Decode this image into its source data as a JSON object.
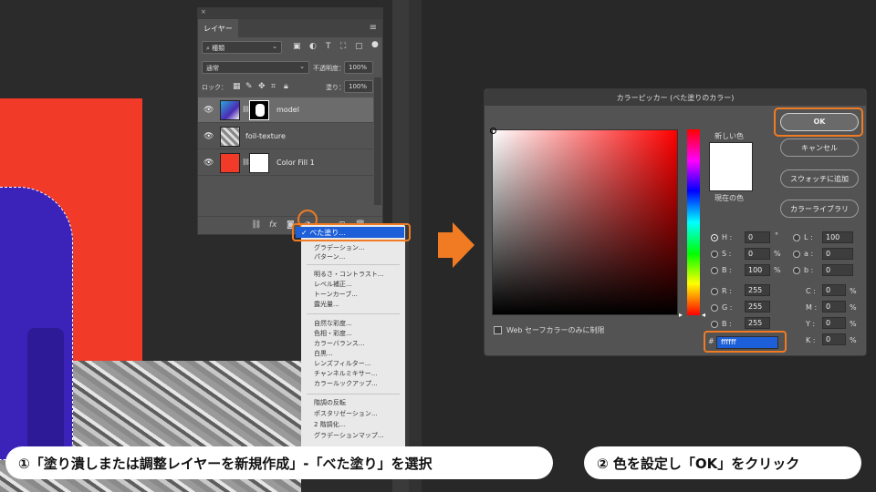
{
  "layers_panel": {
    "close": "×",
    "tab": "レイヤー",
    "menu_icon": "≡",
    "filter_select": "種類",
    "blend_mode": "通常",
    "opacity_label": "不透明度：",
    "opacity_value": "100%",
    "lock_label": "ロック：",
    "fill_label": "塗り：",
    "fill_value": "100%",
    "layers": [
      {
        "name": "model"
      },
      {
        "name": "foil-texture"
      },
      {
        "name": "Color Fill 1"
      }
    ],
    "bottom_icons": [
      "link-icon",
      "fx-icon",
      "mask-icon",
      "adjustment-icon",
      "folder-icon",
      "new-layer-icon",
      "trash-icon"
    ]
  },
  "menu": {
    "items_top": [
      "べた塗り...",
      "グラデーション...",
      "パターン..."
    ],
    "items_group2": [
      "明るさ・コントラスト...",
      "レベル補正...",
      "トーンカーブ...",
      "露光量..."
    ],
    "items_group3": [
      "自然な彩度...",
      "色相・彩度...",
      "カラーバランス...",
      "白黒...",
      "レンズフィルター...",
      "チャンネルミキサー...",
      "カラールックアップ..."
    ],
    "items_group4": [
      "階調の反転",
      "ポスタリゼーション...",
      "2 階調化...",
      "グラデーションマップ..."
    ],
    "checked_item": "✓ べた塗り..."
  },
  "picker": {
    "title": "カラーピッカー (べた塗りのカラー)",
    "new_color_label": "新しい色",
    "current_color_label": "現在の色",
    "swatch_color": "#ffffff",
    "buttons": {
      "ok": "OK",
      "cancel": "キャンセル",
      "add_swatch": "スウォッチに追加",
      "color_libraries": "カラーライブラリ"
    },
    "fields": {
      "H": {
        "label": "H :",
        "value": "0",
        "unit": "°"
      },
      "S": {
        "label": "S :",
        "value": "0",
        "unit": "%"
      },
      "B": {
        "label": "B :",
        "value": "100",
        "unit": "%"
      },
      "R": {
        "label": "R :",
        "value": "255"
      },
      "G": {
        "label": "G :",
        "value": "255"
      },
      "Bl": {
        "label": "B :",
        "value": "255"
      },
      "L": {
        "label": "L :",
        "value": "100"
      },
      "a": {
        "label": "a :",
        "value": "0"
      },
      "b": {
        "label": "b :",
        "value": "0"
      },
      "C": {
        "label": "C :",
        "value": "0",
        "unit": "%"
      },
      "M": {
        "label": "M :",
        "value": "0",
        "unit": "%"
      },
      "Y": {
        "label": "Y :",
        "value": "0",
        "unit": "%"
      },
      "K": {
        "label": "K :",
        "value": "0",
        "unit": "%"
      }
    },
    "websafe_label": "Web セーフカラーのみに制限",
    "hex_prefix": "#",
    "hex_value": "ffffff"
  },
  "captions": {
    "step1": "①「塗り潰しまたは調整レイヤーを新規作成」-「べた塗り」を選択",
    "step2": "② 色を設定し「OK」をクリック"
  },
  "colors": {
    "accent": "#f07b23",
    "selection": "#1d5fd8",
    "fill_red": "#f23a28"
  }
}
